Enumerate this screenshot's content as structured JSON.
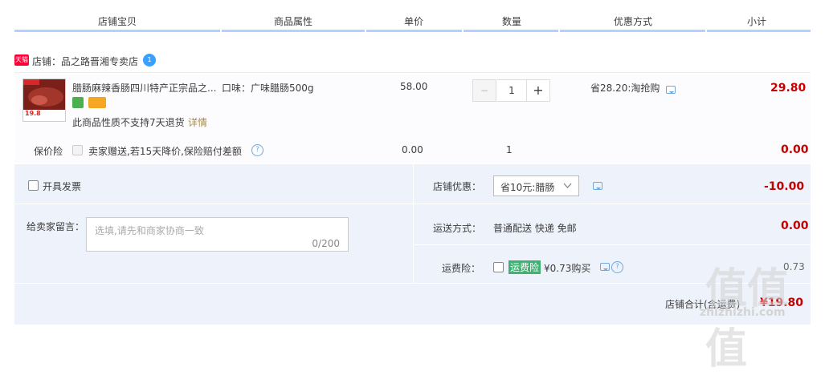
{
  "header": {
    "col_item": "店铺宝贝",
    "col_attr": "商品属性",
    "col_price": "单价",
    "col_qty": "数量",
    "col_promo": "优惠方式",
    "col_subtotal": "小计"
  },
  "shop": {
    "tmall_badge": "天猫",
    "name": "店铺：品之路晋湘专卖店",
    "badge": "1"
  },
  "item": {
    "title": "腊肠麻辣香肠四川特产正宗品之...",
    "attribute": "口味：广味腊肠500g",
    "price": "58.00",
    "quantity": "1",
    "promo": "省28.20:淘抢购",
    "subtotal": "29.80",
    "return_note": "此商品性质不支持7天退货",
    "detail_link": "详情",
    "image_price": "19.8"
  },
  "insurance": {
    "label": "保价险",
    "desc": "卖家赠送,若15天降价,保险赔付差额",
    "price": "0.00",
    "qty": "1",
    "subtotal": "0.00"
  },
  "invoice": {
    "label": "开具发票"
  },
  "message": {
    "label": "给卖家留言：",
    "placeholder": "选填,请先和商家协商一致",
    "counter": "0/200"
  },
  "shop_discount": {
    "label": "店铺优惠：",
    "selected": "省10元:腊肠",
    "amount": "-10.00"
  },
  "shipping": {
    "label": "运送方式：",
    "method": "普通配送 快递 免邮",
    "amount": "0.00"
  },
  "freight_insurance": {
    "label": "运费险：",
    "tag": "运费险",
    "offer": "¥0.73购买",
    "amount": "0.73"
  },
  "total": {
    "label": "店铺合计(含运费)",
    "amount": "¥19.80"
  },
  "watermark": {
    "big": "值值值",
    "small": "zhizhizhi.com"
  },
  "colors": {
    "accent_red": "#c40000",
    "header_line": "#b2d1ff",
    "panel_bg": "#eef3fb",
    "tag_green": "#3cb371"
  }
}
